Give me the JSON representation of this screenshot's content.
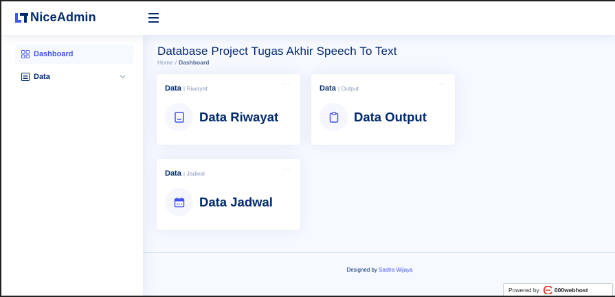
{
  "app": {
    "logo_text": "NiceAdmin"
  },
  "sidebar": {
    "items": [
      {
        "label": "Dashboard",
        "icon": "grid-icon",
        "active": true
      },
      {
        "label": "Data",
        "icon": "layout-text-icon",
        "has_submenu": true
      }
    ]
  },
  "main": {
    "title": "Database Project Tugas Akhir Speech To Text",
    "breadcrumb": [
      "Home",
      "Dashboard"
    ],
    "cards": [
      {
        "title": "Data",
        "subtitle": "| Riwayat",
        "label": "Data Riwayat",
        "icon": "journal-icon"
      },
      {
        "title": "Data",
        "subtitle": "| Output",
        "label": "Data Output",
        "icon": "clipboard-icon"
      },
      {
        "title": "Data",
        "subtitle": "| Jadwal",
        "label": "Data Jadwal",
        "icon": "calendar-icon"
      }
    ],
    "card_menu": "···"
  },
  "footer": {
    "prefix": "Designed by",
    "author": "Sastra Wijaya"
  },
  "badge": {
    "prefix": "Powered by",
    "brand": "000webhost"
  },
  "colors": {
    "primary": "#4154f1",
    "navy": "#012970",
    "background": "#f6f9ff",
    "muted": "#899bbd"
  }
}
